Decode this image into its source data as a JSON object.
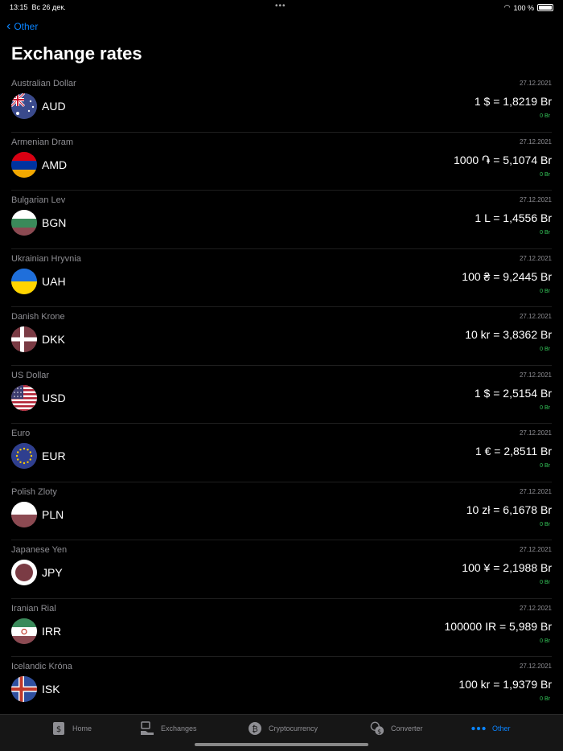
{
  "status": {
    "time": "13:15",
    "date": "Вс 26 дек.",
    "battery": "100 %"
  },
  "nav": {
    "back_label": "Other"
  },
  "title": "Exchange rates",
  "currencies": [
    {
      "name": "Australian Dollar",
      "code": "AUD",
      "date": "27.12.2021",
      "rate": "1 $ = 1,8219 Br",
      "change": "0 Br"
    },
    {
      "name": "Armenian Dram",
      "code": "AMD",
      "date": "27.12.2021",
      "rate": "1000 ֏ = 5,1074 Br",
      "change": "0 Br"
    },
    {
      "name": "Bulgarian Lev",
      "code": "BGN",
      "date": "27.12.2021",
      "rate": "1 L = 1,4556 Br",
      "change": "0 Br"
    },
    {
      "name": "Ukrainian Hryvnia",
      "code": "UAH",
      "date": "27.12.2021",
      "rate": "100 ₴ = 9,2445 Br",
      "change": "0 Br"
    },
    {
      "name": "Danish Krone",
      "code": "DKK",
      "date": "27.12.2021",
      "rate": "10 kr = 3,8362 Br",
      "change": "0 Br"
    },
    {
      "name": "US Dollar",
      "code": "USD",
      "date": "27.12.2021",
      "rate": "1 $ = 2,5154 Br",
      "change": "0 Br"
    },
    {
      "name": "Euro",
      "code": "EUR",
      "date": "27.12.2021",
      "rate": "1 € = 2,8511 Br",
      "change": "0 Br"
    },
    {
      "name": "Polish Zloty",
      "code": "PLN",
      "date": "27.12.2021",
      "rate": "10 zł = 6,1678 Br",
      "change": "0 Br"
    },
    {
      "name": "Japanese Yen",
      "code": "JPY",
      "date": "27.12.2021",
      "rate": "100 ¥ = 2,1988 Br",
      "change": "0 Br"
    },
    {
      "name": "Iranian Rial",
      "code": "IRR",
      "date": "27.12.2021",
      "rate": "100000 IR = 5,989 Br",
      "change": "0 Br"
    },
    {
      "name": "Icelandic Króna",
      "code": "ISK",
      "date": "27.12.2021",
      "rate": "100 kr = 1,9379 Br",
      "change": "0 Br"
    }
  ],
  "tabs": [
    {
      "label": "Home",
      "icon": "dollar-doc-icon"
    },
    {
      "label": "Exchanges",
      "icon": "exchange-hand-icon"
    },
    {
      "label": "Cryptocurrency",
      "icon": "bitcoin-icon"
    },
    {
      "label": "Converter",
      "icon": "converter-coins-icon"
    },
    {
      "label": "Other",
      "icon": "more-dots-icon",
      "active": true
    }
  ],
  "colors": {
    "accent": "#0a84ff",
    "change_positive": "#34c759",
    "background": "#000000"
  }
}
